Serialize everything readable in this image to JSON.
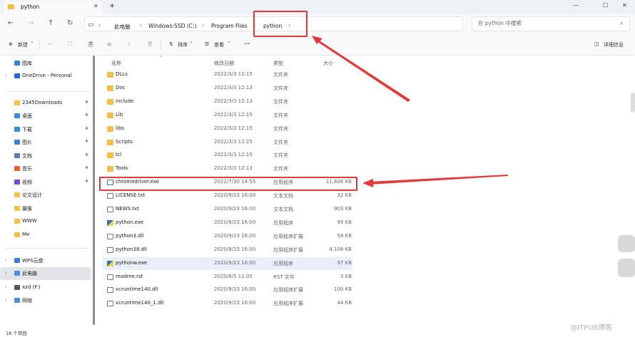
{
  "tab": {
    "title": "python",
    "icon": "folder-icon",
    "close": "✕",
    "new": "+"
  },
  "window": {
    "minimize": "—",
    "maximize": "☐",
    "close": "✕"
  },
  "nav": {
    "back": "←",
    "forward": "→",
    "up": "↑",
    "refresh": "↻"
  },
  "breadcrumb": [
    "此电脑",
    "Windows-SSD (C:)",
    "Program Files",
    "python"
  ],
  "breadcrumb_sep": "›",
  "search": {
    "placeholder": "在 python 中搜索",
    "icon": "search-icon"
  },
  "toolbar": {
    "new_label": "新建",
    "sort_label": "排序",
    "view_label": "查看",
    "more_label": "···",
    "details_label": "详细信息"
  },
  "columns": {
    "name": "名称",
    "date": "修改日期",
    "type": "类型",
    "size": "大小"
  },
  "sidebar": {
    "items": [
      {
        "label": "图库",
        "color": "#3f7fd6",
        "pinned": false
      },
      {
        "label": "OneDrive - Personal",
        "color": "#2a6ad1",
        "pinned": false
      },
      {
        "label": "2345Downloads",
        "color": "#f2c04a",
        "pinned": true
      },
      {
        "label": "桌面",
        "color": "#3a8ad6",
        "pinned": true
      },
      {
        "label": "下载",
        "color": "#2f8fd8",
        "pinned": true
      },
      {
        "label": "图片",
        "color": "#3f7fd6",
        "pinned": true
      },
      {
        "label": "文档",
        "color": "#5a7fa8",
        "pinned": true
      },
      {
        "label": "音乐",
        "color": "#e0623a",
        "pinned": true
      },
      {
        "label": "视频",
        "color": "#7a4ad0",
        "pinned": true
      },
      {
        "label": "论文设计",
        "color": "#f2c04a",
        "pinned": false
      },
      {
        "label": "摄像",
        "color": "#f2c04a",
        "pinned": false
      },
      {
        "label": "WWW",
        "color": "#f2c04a",
        "pinned": false
      },
      {
        "label": "Me",
        "color": "#f2c04a",
        "pinned": false
      },
      {
        "label": "WPS云盘",
        "color": "#3a7bd5",
        "pinned": false
      },
      {
        "label": "此电脑",
        "color": "#4a90d9",
        "pinned": false
      },
      {
        "label": "xzd (F:)",
        "color": "#555555",
        "pinned": false
      },
      {
        "label": "网络",
        "color": "#4a90d9",
        "pinned": false
      }
    ]
  },
  "files": [
    {
      "name": "DLLs",
      "date": "2022/3/3 12:15",
      "type": "文件夹",
      "size": "",
      "kind": "folder"
    },
    {
      "name": "Doc",
      "date": "2022/3/3 12:13",
      "type": "文件夹",
      "size": "",
      "kind": "folder"
    },
    {
      "name": "include",
      "date": "2022/3/3 12:13",
      "type": "文件夹",
      "size": "",
      "kind": "folder"
    },
    {
      "name": "Lib",
      "date": "2022/3/3 12:15",
      "type": "文件夹",
      "size": "",
      "kind": "folder"
    },
    {
      "name": "libs",
      "date": "2022/3/3 12:15",
      "type": "文件夹",
      "size": "",
      "kind": "folder"
    },
    {
      "name": "Scripts",
      "date": "2022/3/3 12:25",
      "type": "文件夹",
      "size": "",
      "kind": "folder"
    },
    {
      "name": "tcl",
      "date": "2022/3/3 12:15",
      "type": "文件夹",
      "size": "",
      "kind": "folder"
    },
    {
      "name": "Tools",
      "date": "2022/3/3 12:13",
      "type": "文件夹",
      "size": "",
      "kind": "folder"
    },
    {
      "name": "chromedriver.exe",
      "date": "2022/7/30 14:55",
      "type": "应用程序",
      "size": "11,606 KB",
      "kind": "exe"
    },
    {
      "name": "LICENSE.txt",
      "date": "2020/9/23 16:00",
      "type": "文本文档",
      "size": "32 KB",
      "kind": "file"
    },
    {
      "name": "NEWS.txt",
      "date": "2020/9/23 16:00",
      "type": "文本文档",
      "size": "903 KB",
      "kind": "file"
    },
    {
      "name": "python.exe",
      "date": "2020/9/23 16:00",
      "type": "应用程序",
      "size": "99 KB",
      "kind": "py"
    },
    {
      "name": "python3.dll",
      "date": "2020/9/23 16:00",
      "type": "应用程序扩展",
      "size": "58 KB",
      "kind": "file"
    },
    {
      "name": "python38.dll",
      "date": "2020/9/23 16:00",
      "type": "应用程序扩展",
      "size": "4,108 KB",
      "kind": "file"
    },
    {
      "name": "pythonw.exe",
      "date": "2020/9/23 16:00",
      "type": "应用程序",
      "size": "97 KB",
      "kind": "py"
    },
    {
      "name": "readme.rst",
      "date": "2020/8/5 11:05",
      "type": "RST 文件",
      "size": "3 KB",
      "kind": "file"
    },
    {
      "name": "vcruntime140.dll",
      "date": "2020/9/23 16:00",
      "type": "应用程序扩展",
      "size": "100 KB",
      "kind": "file"
    },
    {
      "name": "vcruntime140_1.dll",
      "date": "2020/9/23 16:00",
      "type": "应用程序扩展",
      "size": "44 KB",
      "kind": "file"
    }
  ],
  "status": {
    "count": "18 个项目"
  },
  "watermark": "@ITPUB博客",
  "annotation_color": "#e03a3a"
}
